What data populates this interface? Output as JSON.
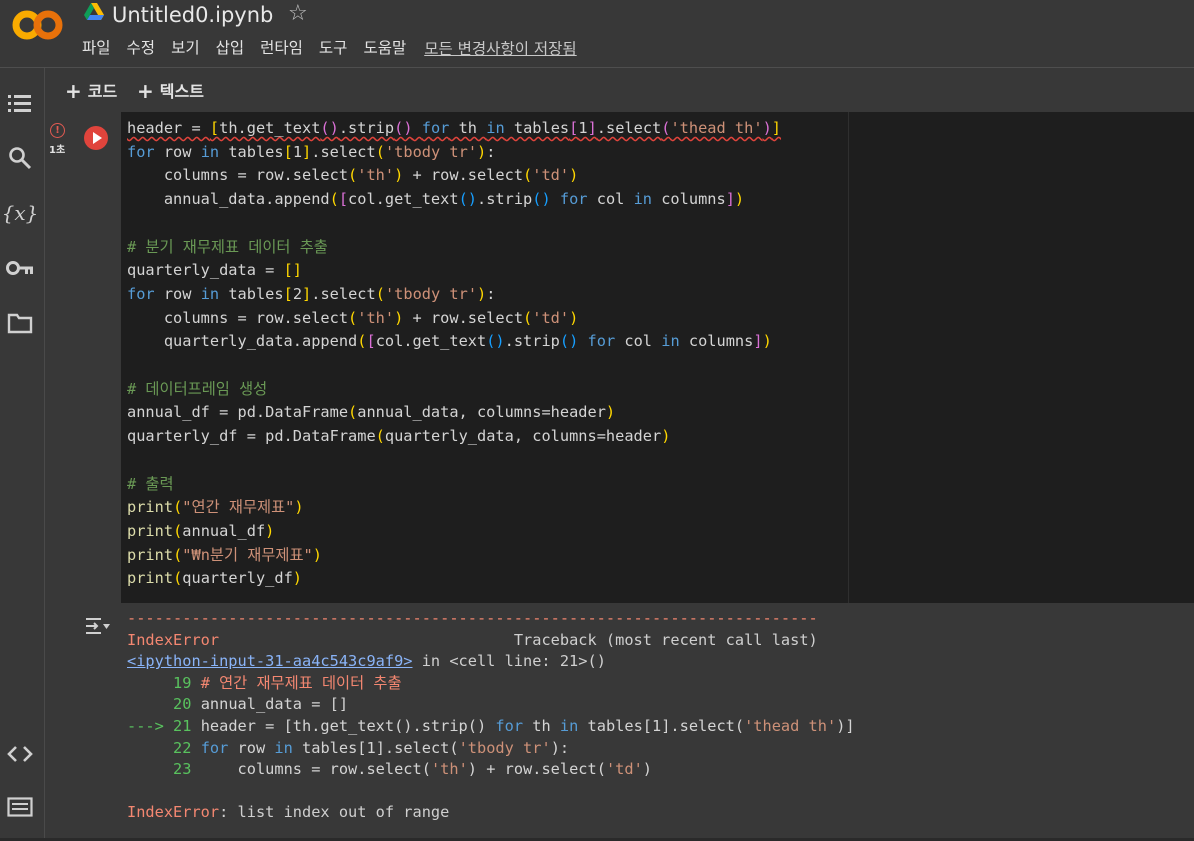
{
  "app": {
    "file_title": "Untitled0.ipynb"
  },
  "menu": [
    "파일",
    "수정",
    "보기",
    "삽입",
    "런타임",
    "도구",
    "도움말"
  ],
  "save_status": "모든 변경사항이 저장됨",
  "toolbar": {
    "add_code": "코드",
    "add_text": "텍스트"
  },
  "cell": {
    "exec_time": "1초"
  },
  "code_lines": [
    "header = [th.get_text().strip() for th in tables[1].select('thead th')]",
    "for row in tables[1].select('tbody tr'):",
    "    columns = row.select('th') + row.select('td')",
    "    annual_data.append([col.get_text().strip() for col in columns])",
    "",
    "# 분기 재무제표 데이터 추출",
    "quarterly_data = []",
    "for row in tables[2].select('tbody tr'):",
    "    columns = row.select('th') + row.select('td')",
    "    quarterly_data.append([col.get_text().strip() for col in columns])",
    "",
    "# 데이터프레임 생성",
    "annual_df = pd.DataFrame(annual_data, columns=header)",
    "quarterly_df = pd.DataFrame(quarterly_data, columns=header)",
    "",
    "# 출력",
    "print(\"연간 재무제표\")",
    "print(annual_df)",
    "print(\"₩n분기 재무제표\")",
    "print(quarterly_df)"
  ],
  "output": {
    "separator": "---------------------------------------------------------------------------",
    "error_type": "IndexError",
    "traceback_label": "Traceback (most recent call last)",
    "source_link": "<ipython-input-31-aa4c543c9af9>",
    "source_rest": " in <cell line: 21>()",
    "tb_lines": [
      "     19 # 연간 재무제표 데이터 추출",
      "     20 annual_data = []",
      "---> 21 header = [th.get_text().strip() for th in tables[1].select('thead th')]",
      "     22 for row in tables[1].select('tbody tr'):",
      "     23     columns = row.select('th') + row.select('td')"
    ],
    "final_type": "IndexError",
    "final_msg": ": list index out of range"
  },
  "colors": {
    "run_button": "#e0443c",
    "error_text": "#f48771",
    "keyword": "#569cd6",
    "string": "#ce9178",
    "comment": "#6a9955"
  }
}
